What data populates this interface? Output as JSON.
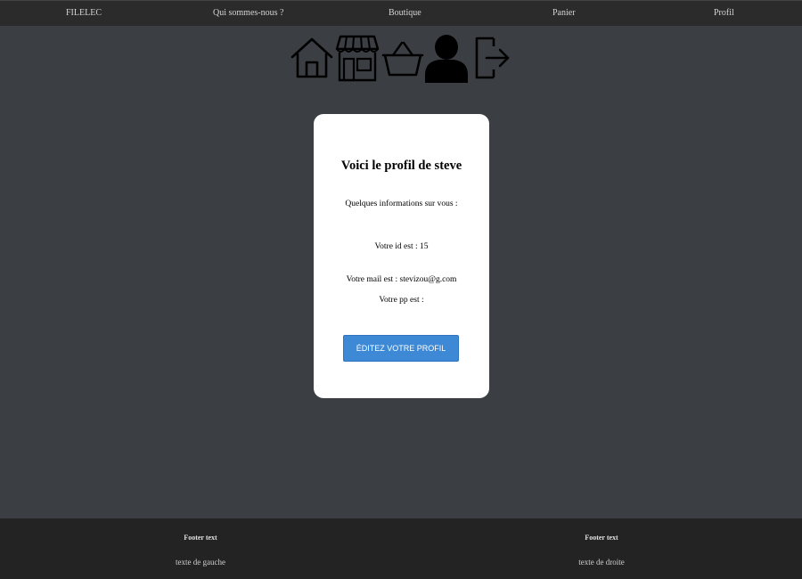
{
  "nav": {
    "brand": "FILELEC",
    "about": "Qui sommes-nous ?",
    "shop": "Boutique",
    "cart": "Panier",
    "profile": "Profil"
  },
  "icons": [
    "home-icon",
    "store-icon",
    "basket-icon",
    "user-icon",
    "logout-icon"
  ],
  "profile_card": {
    "title": "Voici le profil de steve",
    "intro": "Quelques informations sur vous :",
    "id_line": "Votre id est : 15",
    "mail_line": "Votre mail est : stevizou@g.com",
    "pp_line": "Votre pp est :",
    "edit_button": "ÉDITEZ VOTRE PROFIL"
  },
  "footer": {
    "left_heading": "Footer text",
    "left_text": "texte de gauche",
    "right_heading": "Footer text",
    "right_text": "texte de droite"
  },
  "colors": {
    "page_background": "#3b3e43",
    "nav_background": "#2b2b2b",
    "footer_background": "#232323",
    "button": "#3d89d6"
  }
}
